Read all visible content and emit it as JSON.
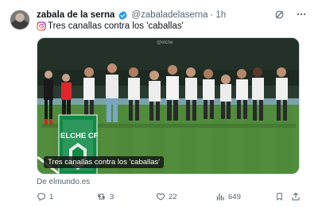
{
  "author": {
    "name": "zabala de la serna",
    "handle": "@zabaladelaserna",
    "separator": "·",
    "time": "1h"
  },
  "tweet": {
    "text": "Tres canallas contra los 'caballas'"
  },
  "media": {
    "caption": "Tres canallas contra los 'caballas'",
    "sign_text": "ELCHE CF",
    "watermark": "@elche"
  },
  "link_source": "De elmundo.es",
  "actions": {
    "replies": "1",
    "retweets": "3",
    "likes": "22",
    "views": "649"
  },
  "icons": [
    "avatar",
    "verified-icon",
    "grok-icon",
    "more-icon",
    "instagram-icon",
    "reply-icon",
    "retweet-icon",
    "like-icon",
    "views-icon",
    "bookmark-icon",
    "share-icon"
  ],
  "colors": {
    "text": "#0f1419",
    "secondary": "#536471",
    "verified": "#1d9bf0",
    "pitch": "#4f8a3a",
    "sign": "#0f8a45"
  }
}
